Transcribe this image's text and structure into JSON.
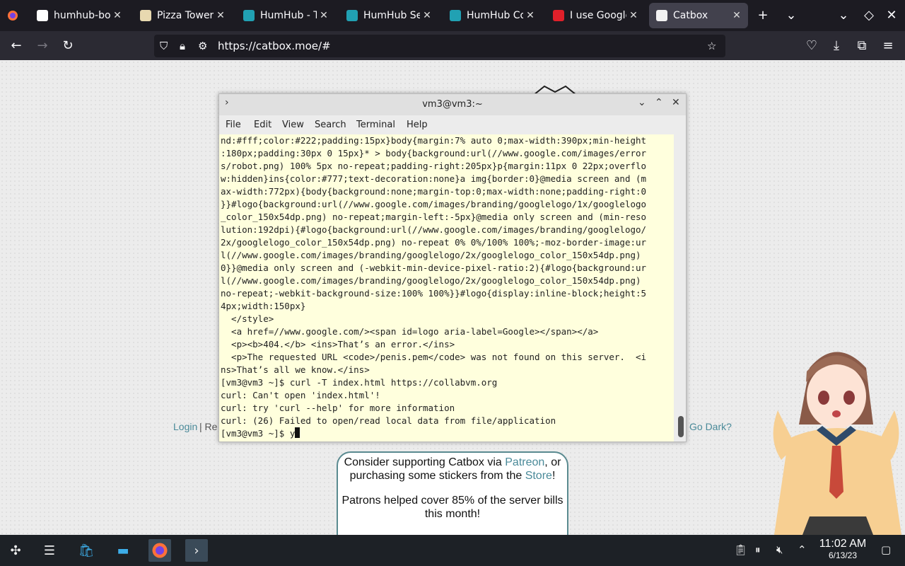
{
  "browser": {
    "tabs": [
      {
        "title": "humhub-bot",
        "icon": "github-icon",
        "color": "#ffffff"
      },
      {
        "title": "Pizza Tower",
        "icon": "pizza-tower-icon",
        "color": "#e8d9b0"
      },
      {
        "title": "HumHub - Th",
        "icon": "humhub-icon",
        "color": "#21a1b3"
      },
      {
        "title": "HumHub Setu",
        "icon": "humhub-icon",
        "color": "#21a1b3"
      },
      {
        "title": "HumHub Con",
        "icon": "humhub-icon",
        "color": "#21a1b3"
      },
      {
        "title": "I use Google",
        "icon": "opera-icon",
        "color": "#e0202a"
      },
      {
        "title": "Catbox",
        "icon": "catbox-icon",
        "color": "#f2f2f2"
      }
    ],
    "url": "https://catbox.moe/#"
  },
  "terminal": {
    "title": "vm3@vm3:~",
    "menu": [
      "File",
      "Edit",
      "View",
      "Search",
      "Terminal",
      "Help"
    ],
    "lines": [
      "nd:#fff;color:#222;padding:15px}body{margin:7% auto 0;max-width:390px;min-height",
      ":180px;padding:30px 0 15px}* > body{background:url(//www.google.com/images/error",
      "s/robot.png) 100% 5px no-repeat;padding-right:205px}p{margin:11px 0 22px;overflo",
      "w:hidden}ins{color:#777;text-decoration:none}a img{border:0}@media screen and (m",
      "ax-width:772px){body{background:none;margin-top:0;max-width:none;padding-right:0",
      "}}#logo{background:url(//www.google.com/images/branding/googlelogo/1x/googlelogo",
      "_color_150x54dp.png) no-repeat;margin-left:-5px}@media only screen and (min-reso",
      "lution:192dpi){#logo{background:url(//www.google.com/images/branding/googlelogo/",
      "2x/googlelogo_color_150x54dp.png) no-repeat 0% 0%/100% 100%;-moz-border-image:ur",
      "l(//www.google.com/images/branding/googlelogo/2x/googlelogo_color_150x54dp.png)",
      "0}}@media only screen and (-webkit-min-device-pixel-ratio:2){#logo{background:ur",
      "l(//www.google.com/images/branding/googlelogo/2x/googlelogo_color_150x54dp.png)",
      "no-repeat;-webkit-background-size:100% 100%}}#logo{display:inline-block;height:5",
      "4px;width:150px}",
      "  </style>",
      "  <a href=//www.google.com/><span id=logo aria-label=Google></span></a>",
      "  <p><b>404.</b> <ins>That’s an error.</ins>",
      "  <p>The requested URL <code>/penis.pem</code> was not found on this server.  <i",
      "ns>That’s all we know.</ins>",
      "[vm3@vm3 ~]$ curl -T index.html https://collabvm.org",
      "curl: Can't open 'index.html'!",
      "curl: try 'curl --help' for more information",
      "curl: (26) Failed to open/read local data from file/application"
    ],
    "prompt": "[vm3@vm3 ~]$ ",
    "input": "y"
  },
  "page": {
    "left_link_login": "Login",
    "left_link_sep": " | Re",
    "right_link": "Go Dark?",
    "support_line1_a": "Consider supporting Catbox via ",
    "support_link_patreon": "Patreon",
    "support_line1_b": ", or purchasing some stickers from the ",
    "support_link_store": "Store",
    "support_line1_c": "!",
    "support_line2": "Patrons helped cover 85% of the server bills this month!"
  },
  "taskbar": {
    "time": "11:02 AM",
    "date": "6/13/23"
  }
}
